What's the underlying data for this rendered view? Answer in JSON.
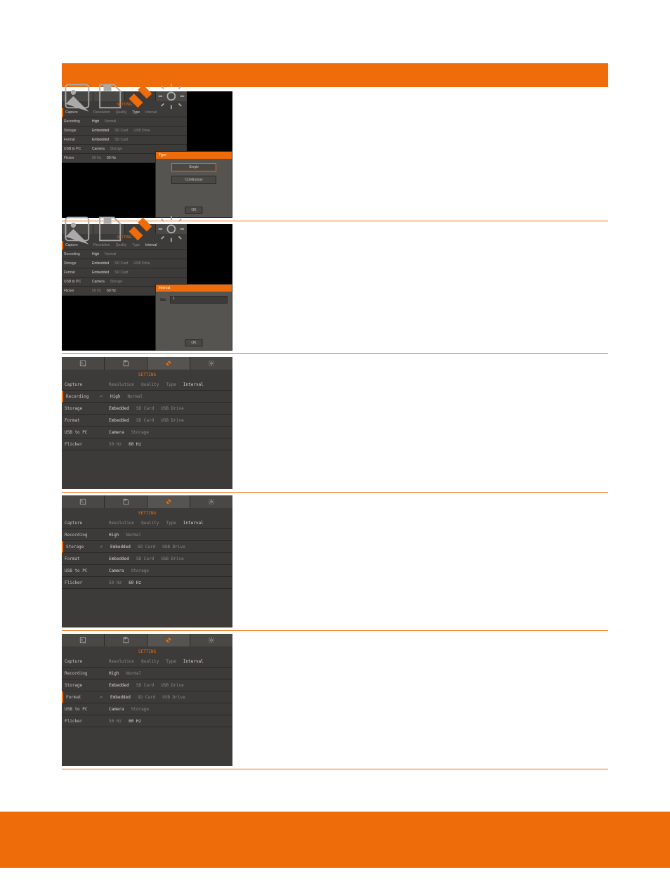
{
  "settings": {
    "title": "SETTING",
    "rows": [
      {
        "key": "capture",
        "label": "Capture",
        "vals": [
          "Resolution",
          "Quality",
          "Type",
          "Interval"
        ],
        "bright": [
          3
        ]
      },
      {
        "key": "recording",
        "label": "Recording",
        "vals": [
          "High",
          "Normal"
        ]
      },
      {
        "key": "storage",
        "label": "Storage",
        "vals": [
          "Embedded",
          "SD Card",
          "USB Drive"
        ]
      },
      {
        "key": "format",
        "label": "Format",
        "vals": [
          "Embedded",
          "SD Card",
          "USB Drive"
        ]
      },
      {
        "key": "usbtopc",
        "label": "USB to PC",
        "vals": [
          "Camera",
          "Storage"
        ]
      },
      {
        "key": "flicker",
        "label": "Flicker",
        "vals": [
          "50 Hz",
          "60 Hz"
        ]
      }
    ]
  },
  "section1": {
    "dialog_title": "Type",
    "options": [
      "Single",
      "Continuous"
    ],
    "button": "OK",
    "selected_rows": [
      "capture"
    ],
    "row_active_col": {
      "capture": 2
    }
  },
  "section2": {
    "dialog_title": "Interval",
    "input_label": "Sec.",
    "input_value": "1",
    "button": "OK",
    "selected_rows": [
      "capture"
    ],
    "row_active_col": {
      "capture": 3
    }
  },
  "section3": {
    "selected_rows": [
      "recording"
    ],
    "arrow_on": "recording",
    "row_active_col": {
      "recording": 0
    }
  },
  "section4": {
    "selected_rows": [
      "storage"
    ],
    "arrow_on": "storage",
    "row_active_col": {
      "storage": 0
    }
  },
  "section5": {
    "selected_rows": [
      "format"
    ],
    "arrow_on": "format",
    "row_active_col": {
      "format": 0
    }
  }
}
